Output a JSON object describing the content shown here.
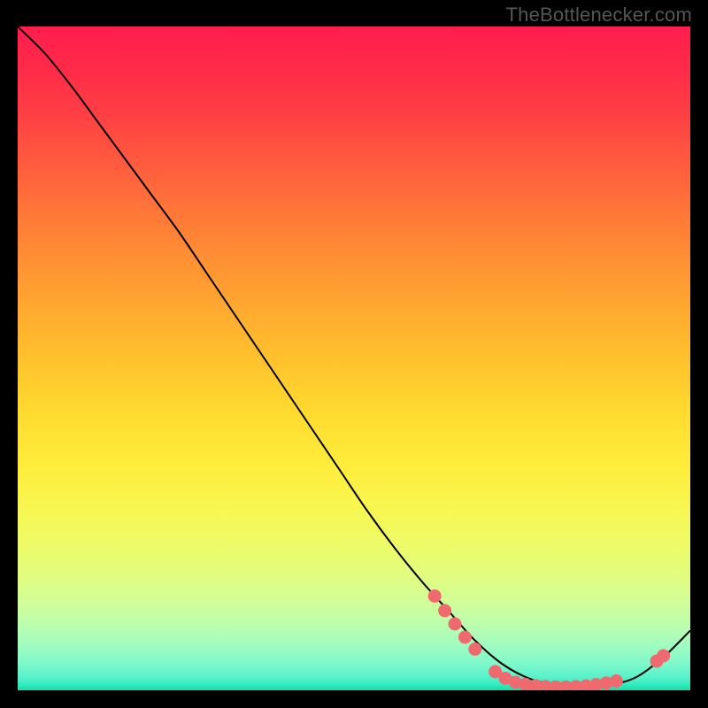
{
  "watermark": "TheBottlenecker.com",
  "chart_data": {
    "type": "line",
    "title": "",
    "xlabel": "",
    "ylabel": "",
    "xlim": [
      0,
      100
    ],
    "ylim": [
      0,
      100
    ],
    "grid": false,
    "background": "rainbow-gradient",
    "series": [
      {
        "name": "bottleneck-curve",
        "x": [
          0,
          4,
          8,
          12,
          16,
          20,
          24,
          28,
          32,
          36,
          40,
          44,
          48,
          52,
          56,
          60,
          64,
          68,
          72,
          76,
          80,
          84,
          88,
          92,
          96,
          100
        ],
        "y": [
          100,
          96,
          91,
          85.5,
          80,
          74.5,
          69,
          63,
          57,
          51,
          45,
          39,
          33,
          27,
          21.5,
          16.5,
          12,
          7.5,
          4,
          1.8,
          0.8,
          0.5,
          0.8,
          2,
          5,
          9
        ]
      }
    ],
    "markers": [
      {
        "x": 62,
        "y": 14.2
      },
      {
        "x": 63.5,
        "y": 12.0
      },
      {
        "x": 65,
        "y": 10.0
      },
      {
        "x": 66.5,
        "y": 8.0
      },
      {
        "x": 68,
        "y": 6.2
      },
      {
        "x": 71,
        "y": 2.8
      },
      {
        "x": 72.5,
        "y": 1.8
      },
      {
        "x": 74,
        "y": 1.2
      },
      {
        "x": 75.5,
        "y": 0.9
      },
      {
        "x": 77,
        "y": 0.7
      },
      {
        "x": 78.5,
        "y": 0.55
      },
      {
        "x": 80,
        "y": 0.5
      },
      {
        "x": 81.5,
        "y": 0.5
      },
      {
        "x": 83,
        "y": 0.55
      },
      {
        "x": 84.5,
        "y": 0.65
      },
      {
        "x": 86,
        "y": 0.85
      },
      {
        "x": 87.5,
        "y": 1.1
      },
      {
        "x": 89,
        "y": 1.4
      },
      {
        "x": 95,
        "y": 4.4
      },
      {
        "x": 96,
        "y": 5.2
      }
    ],
    "gradient_stops": [
      {
        "pos": 0.0,
        "color": "#ff1d4e"
      },
      {
        "pos": 0.06,
        "color": "#ff2a49"
      },
      {
        "pos": 0.12,
        "color": "#ff3b45"
      },
      {
        "pos": 0.18,
        "color": "#ff5140"
      },
      {
        "pos": 0.24,
        "color": "#ff683c"
      },
      {
        "pos": 0.3,
        "color": "#ff7e37"
      },
      {
        "pos": 0.36,
        "color": "#ff9333"
      },
      {
        "pos": 0.42,
        "color": "#ffa730"
      },
      {
        "pos": 0.48,
        "color": "#ffbb2d"
      },
      {
        "pos": 0.54,
        "color": "#ffce2d"
      },
      {
        "pos": 0.6,
        "color": "#ffdf31"
      },
      {
        "pos": 0.66,
        "color": "#feec3b"
      },
      {
        "pos": 0.72,
        "color": "#f8f64e"
      },
      {
        "pos": 0.78,
        "color": "#eefb67"
      },
      {
        "pos": 0.83,
        "color": "#e1fd81"
      },
      {
        "pos": 0.87,
        "color": "#cffe9a"
      },
      {
        "pos": 0.905,
        "color": "#b9feb0"
      },
      {
        "pos": 0.935,
        "color": "#9efcc1"
      },
      {
        "pos": 0.96,
        "color": "#7ef8cb"
      },
      {
        "pos": 0.98,
        "color": "#59f2cb"
      },
      {
        "pos": 0.992,
        "color": "#33eabe"
      },
      {
        "pos": 1.0,
        "color": "#11dfa5"
      }
    ]
  },
  "colors": {
    "curve": "#000000",
    "marker_fill": "#ef6a6f",
    "marker_stroke": "#c94a52"
  }
}
